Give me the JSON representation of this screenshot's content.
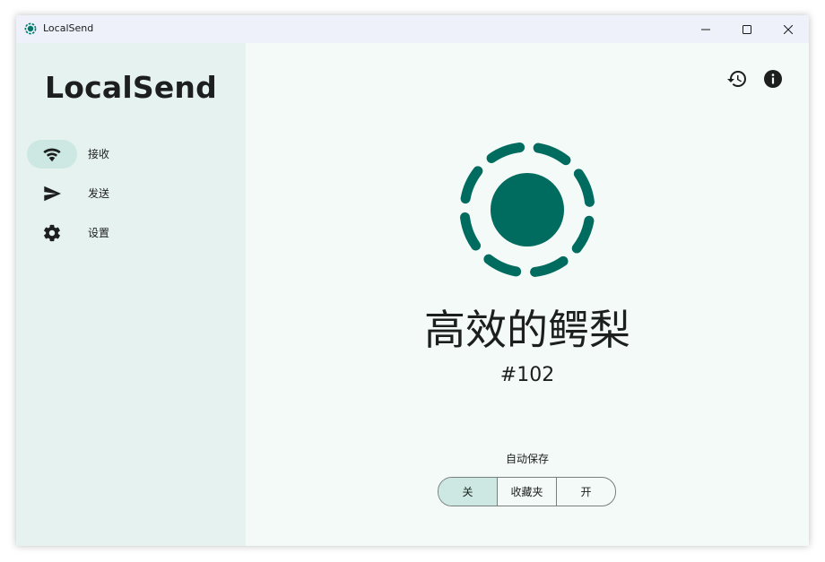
{
  "window": {
    "title": "LocalSend",
    "controls": [
      "minimize-icon",
      "maximize-icon",
      "close-icon"
    ]
  },
  "sidebar": {
    "brand": "LocalSend",
    "items": [
      {
        "label": "接收",
        "icon": "wifi-icon",
        "active": true
      },
      {
        "label": "发送",
        "icon": "send-icon",
        "active": false
      },
      {
        "label": "设置",
        "icon": "gear-icon",
        "active": false
      }
    ]
  },
  "main": {
    "actions": [
      "history-icon",
      "info-icon"
    ],
    "device_name": "高效的鳄梨",
    "device_id": "#102",
    "autosave": {
      "label": "自动保存",
      "options": [
        "关",
        "收藏夹",
        "开"
      ],
      "selected": "关"
    }
  },
  "colors": {
    "accent": "#006b5f",
    "selected_bg": "#cde8e2",
    "sidebar_bg": "#e6f2f0",
    "main_bg": "#f3faf8"
  }
}
